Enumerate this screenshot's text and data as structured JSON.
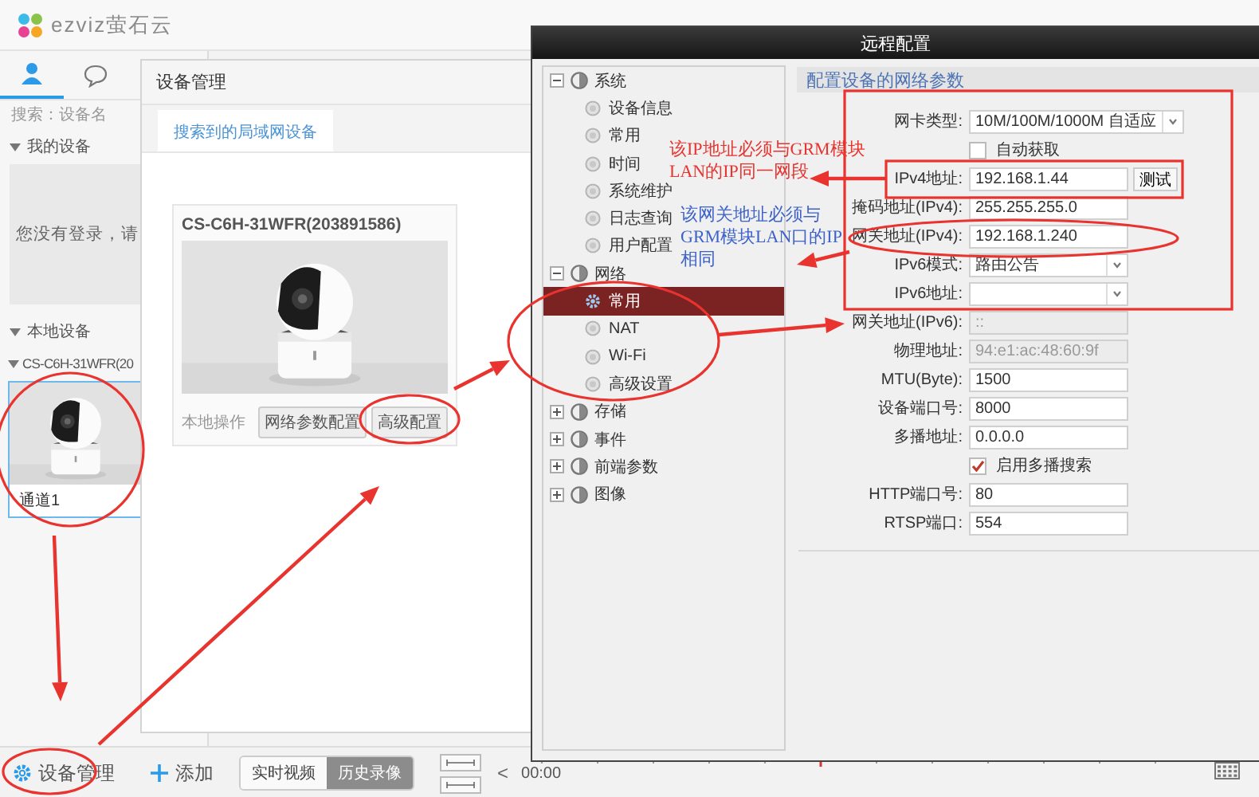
{
  "app": {
    "logo": "ezviz萤石云"
  },
  "sidebar": {
    "tabs": [
      {
        "kind": "person",
        "selected": true
      },
      {
        "kind": "chat",
        "selected": false
      }
    ],
    "search": {
      "placeholder": "搜索：设备名"
    },
    "my_devices": {
      "title": "我的设备",
      "message": "您没有登录，请"
    },
    "local_devices": {
      "title": "本地设备",
      "device": "CS-C6H-31WFR(20",
      "channel": {
        "label": "通道1",
        "selected": true
      }
    }
  },
  "bottom_bar": {
    "manage": "设备管理",
    "add": "添加",
    "modes": [
      {
        "label": "实时视频",
        "selected": false
      },
      {
        "label": "历史录像",
        "selected": true
      }
    ],
    "nav": "<",
    "time": "00:00"
  },
  "device_manager": {
    "title": "设备管理",
    "tabs": [
      {
        "label": "搜索到的局域网设备",
        "selected": true
      }
    ],
    "card": {
      "title": "CS-C6H-31WFR(203891586)",
      "ops_label": "本地操作",
      "buttons": [
        "网络参数配置",
        "高级配置"
      ]
    }
  },
  "remote_config": {
    "title": "远程配置",
    "section_title": "配置设备的网络参数",
    "tree": [
      {
        "label": "系统",
        "expanded": true,
        "selected": false,
        "children": [
          {
            "label": "设备信息",
            "selected": false
          },
          {
            "label": "常用",
            "selected": false
          },
          {
            "label": "时间",
            "selected": false
          },
          {
            "label": "系统维护",
            "selected": false
          },
          {
            "label": "日志查询",
            "selected": false
          },
          {
            "label": "用户配置",
            "selected": false
          }
        ]
      },
      {
        "label": "网络",
        "expanded": true,
        "selected": false,
        "children": [
          {
            "label": "常用",
            "selected": true
          },
          {
            "label": "NAT",
            "selected": false
          },
          {
            "label": "Wi-Fi",
            "selected": false
          },
          {
            "label": "高级设置",
            "selected": false
          }
        ]
      },
      {
        "label": "存储",
        "expanded": false,
        "selected": false
      },
      {
        "label": "事件",
        "expanded": false,
        "selected": false
      },
      {
        "label": "前端参数",
        "expanded": false,
        "selected": false
      },
      {
        "label": "图像",
        "expanded": false,
        "selected": false
      }
    ],
    "fields": [
      {
        "kind": "select",
        "label": "网卡类型:",
        "value": "10M/100M/1000M 自适应",
        "disabled": false
      },
      {
        "kind": "checkbox",
        "label": "自动获取",
        "checked": false,
        "disabled": false
      },
      {
        "kind": "text",
        "label": "IPv4地址:",
        "value": "192.168.1.44",
        "button": "测试",
        "disabled": false
      },
      {
        "kind": "text",
        "label": "掩码地址(IPv4):",
        "value": "255.255.255.0",
        "disabled": false
      },
      {
        "kind": "text",
        "label": "网关地址(IPv4):",
        "value": "192.168.1.240",
        "disabled": false
      },
      {
        "kind": "select",
        "label": "IPv6模式:",
        "value": "路由公告",
        "disabled": false
      },
      {
        "kind": "select",
        "label": "IPv6地址:",
        "disabled": false
      },
      {
        "kind": "text",
        "label": "网关地址(IPv6):",
        "value": "::",
        "disabled": true
      },
      {
        "kind": "text",
        "label": "物理地址:",
        "value": "94:e1:ac:48:60:9f",
        "disabled": true
      },
      {
        "kind": "text",
        "label": "MTU(Byte):",
        "value": "1500",
        "disabled": false
      },
      {
        "kind": "text",
        "label": "设备端口号:",
        "value": "8000",
        "disabled": false
      },
      {
        "kind": "text",
        "label": "多播地址:",
        "value": "0.0.0.0",
        "disabled": false
      },
      {
        "kind": "checkbox",
        "label": "启用多播搜索",
        "checked": true,
        "disabled": false
      },
      {
        "kind": "text",
        "label": "HTTP端口号:",
        "value": "80",
        "disabled": false
      },
      {
        "kind": "text",
        "label": "RTSP端口:",
        "value": "554",
        "disabled": false
      }
    ]
  },
  "annotations": [
    {
      "color": "#e8332e",
      "lines": [
        "该IP地址必须与GRM模块",
        "LAN的IP同一网段"
      ]
    },
    {
      "color": "#3d62c9",
      "lines": [
        "该网关地址必须与",
        "GRM模块LAN口的IP",
        "相同"
      ]
    }
  ]
}
